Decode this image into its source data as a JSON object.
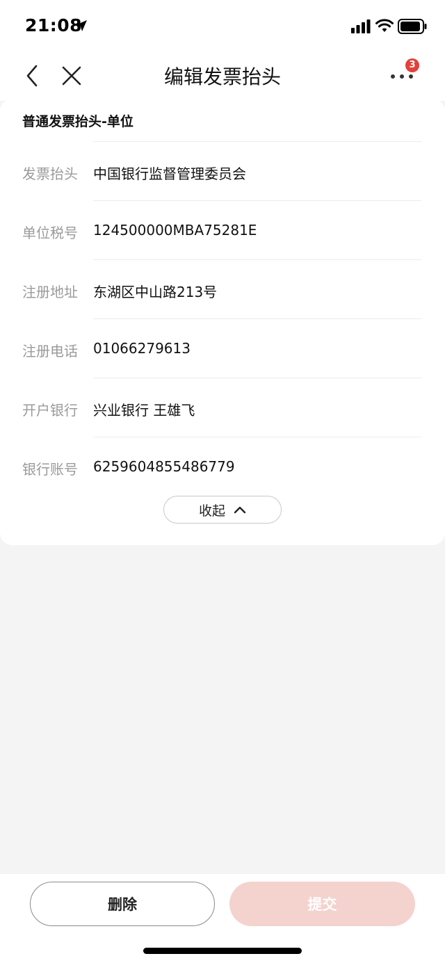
{
  "status_bar": {
    "time": "21:08",
    "icons": [
      "location-arrow-icon",
      "signal-icon",
      "wifi-icon",
      "battery-icon"
    ]
  },
  "nav": {
    "title": "编辑发票抬头",
    "badge_count": "3",
    "icons": [
      "back-icon",
      "close-icon",
      "more-icon"
    ]
  },
  "card": {
    "title": "普通发票抬头-单位",
    "fields": [
      {
        "label": "发票抬头",
        "value": "中国银行监督管理委员会"
      },
      {
        "label": "单位税号",
        "value": "124500000MBA75281E"
      },
      {
        "label": "注册地址",
        "value": "东湖区中山路213号"
      },
      {
        "label": "注册电话",
        "value": "01066279613"
      },
      {
        "label": "开户银行",
        "value": "兴业银行 王雄飞"
      },
      {
        "label": "银行账号",
        "value": "6259604855486779"
      }
    ],
    "collapse_label": "收起"
  },
  "footer": {
    "delete_label": "删除",
    "submit_label": "提交"
  },
  "colors": {
    "accent": "#e2413b",
    "submit_disabled_bg": "#f4d2ce",
    "page_bg": "#f4f4f4",
    "label_gray": "#9a9a9a"
  }
}
